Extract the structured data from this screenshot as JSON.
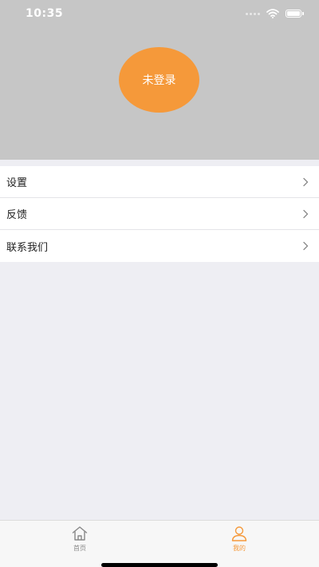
{
  "status_bar": {
    "time": "10:35",
    "icons": [
      "signal-dots-icon",
      "wifi-icon",
      "battery-icon"
    ]
  },
  "header": {
    "background": "#c6c6c6",
    "avatar_label": "未登录",
    "avatar_color": "#f5993a"
  },
  "menu": {
    "items": [
      {
        "label": "设置",
        "icon": "chevron-right-icon"
      },
      {
        "label": "反馈",
        "icon": "chevron-right-icon"
      },
      {
        "label": "联系我们",
        "icon": "chevron-right-icon"
      }
    ]
  },
  "tab_bar": {
    "tabs": [
      {
        "label": "首页",
        "icon": "home-icon",
        "active": false
      },
      {
        "label": "我的",
        "icon": "person-icon",
        "active": true
      }
    ],
    "active_color": "#f5993a",
    "inactive_color": "#888888"
  }
}
